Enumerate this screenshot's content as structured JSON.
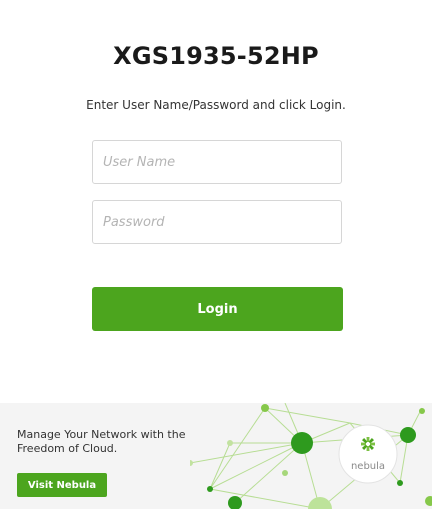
{
  "login": {
    "model": "XGS1935-52HP",
    "instruction": "Enter User Name/Password and click Login.",
    "username_placeholder": "User Name",
    "password_placeholder": "Password",
    "login_label": "Login"
  },
  "banner": {
    "tagline": "Manage Your Network with the Freedom of Cloud.",
    "visit_label": "Visit Nebula",
    "logo_text": "nebula"
  },
  "colors": {
    "brand_green": "#4ca51e",
    "background": "#ffffff",
    "banner_background": "#f4f4f4"
  }
}
